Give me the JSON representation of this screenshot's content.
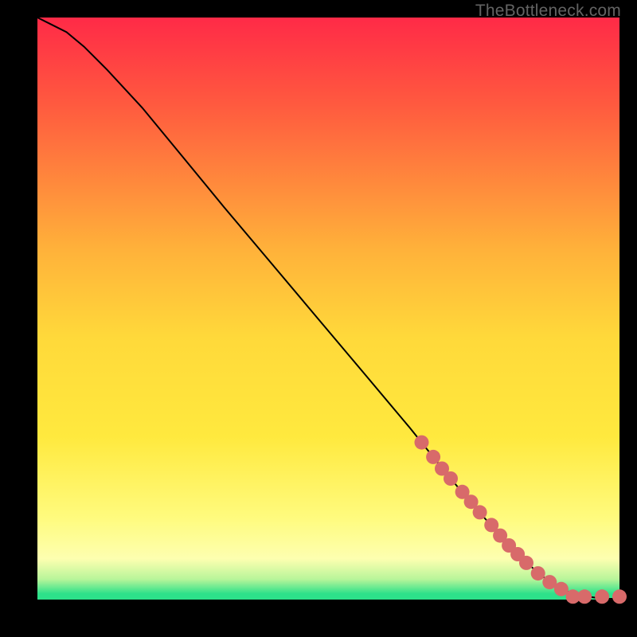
{
  "watermark": "TheBottleneck.com",
  "colors": {
    "bg": "#000000",
    "curve": "#000000",
    "marker_fill": "#d86a6a",
    "marker_stroke": "#d86a6a",
    "grad_top": "#ff2a47",
    "grad_mid1": "#ffb23a",
    "grad_mid2": "#ffe93e",
    "grad_mid3": "#fffb7e",
    "grad_bottom": "#2de18a"
  },
  "chart_data": {
    "type": "line",
    "title": "",
    "xlabel": "",
    "ylabel": "",
    "xlim": [
      0,
      100
    ],
    "ylim": [
      0,
      100
    ],
    "series": [
      {
        "name": "curve",
        "x": [
          0,
          2,
          5,
          8,
          12,
          18,
          25,
          32,
          40,
          48,
          56,
          64,
          70,
          75,
          80,
          85,
          88,
          90,
          92,
          94,
          96,
          98,
          100
        ],
        "y": [
          100,
          99,
          97.5,
          95,
          91,
          84.5,
          76,
          67.5,
          58,
          48.5,
          39,
          29.5,
          22,
          16,
          10.5,
          5.5,
          3,
          1.8,
          1.0,
          0.6,
          0.3,
          0.15,
          0.1
        ]
      }
    ],
    "markers": {
      "name": "highlighted-points",
      "x": [
        66,
        68,
        69.5,
        71,
        73,
        74.5,
        76,
        78,
        79.5,
        81,
        82.5,
        84,
        86,
        88,
        90,
        92,
        94,
        97,
        100
      ],
      "y": [
        27,
        24.5,
        22.5,
        20.8,
        18.5,
        16.8,
        15,
        12.8,
        11,
        9.3,
        7.8,
        6.3,
        4.5,
        3.0,
        1.8,
        0.5,
        0.5,
        0.5,
        0.5
      ]
    }
  }
}
